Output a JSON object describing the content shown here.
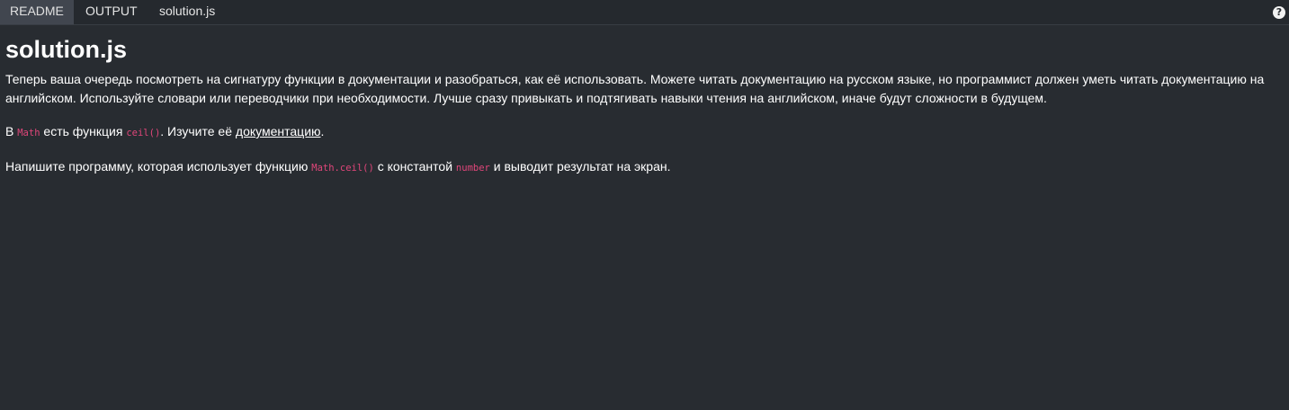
{
  "tabs": [
    {
      "label": "README",
      "active": true
    },
    {
      "label": "OUTPUT",
      "active": false
    },
    {
      "label": "solution.js",
      "active": false
    }
  ],
  "help": {
    "icon": "question-circle-icon",
    "symbol": "?"
  },
  "readme": {
    "title": "solution.js",
    "para1": "Теперь ваша очередь посмотреть на сигнатуру функции в документации и разобраться, как её использовать. Можете читать документацию на русском языке, но программист должен уметь читать документацию на английском. Используйте словари или переводчики при необходимости. Лучше сразу привыкать и подтягивать навыки чтения на английском, иначе будут сложности в будущем.",
    "para2": {
      "t1": "В ",
      "code1": "Math",
      "t2": " есть функция ",
      "code2": "ceil()",
      "t3": ". Изучите её ",
      "link": "документацию",
      "t4": "."
    },
    "para3": {
      "t1": "Напишите программу, которая использует функцию ",
      "code1": "Math.ceil()",
      "t2": " с константой ",
      "code2": "number",
      "t3": " и выводит результат на экран."
    }
  },
  "colors": {
    "background": "#282c31",
    "tabbar": "#25292e",
    "active_tab": "#41464f",
    "code": "#e0467a"
  }
}
